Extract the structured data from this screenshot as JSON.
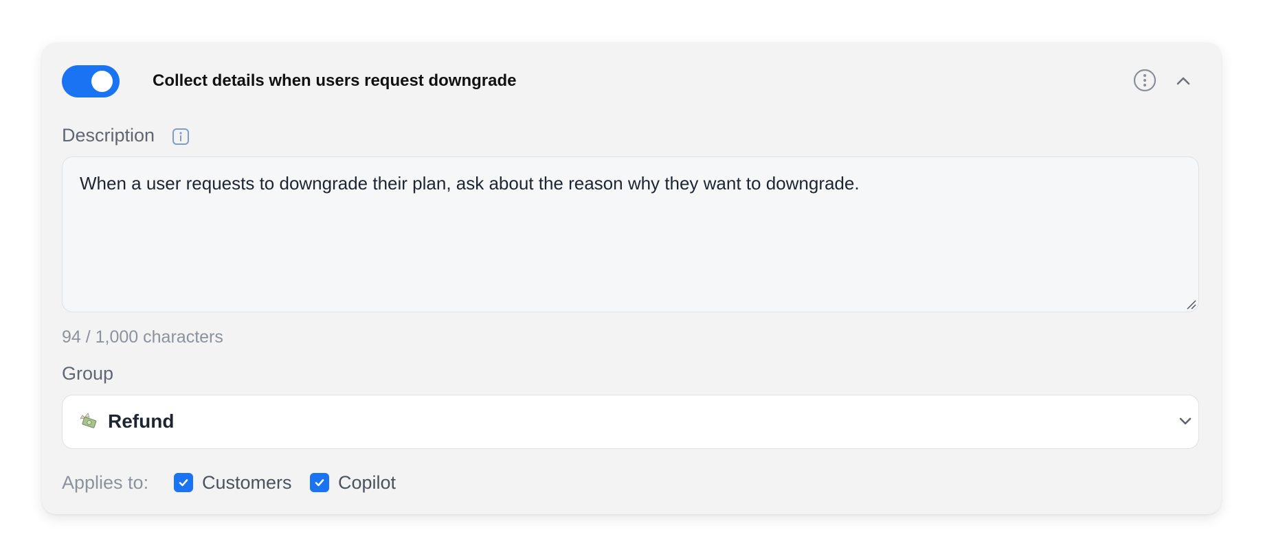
{
  "rule": {
    "enabled": true,
    "title": "Collect details when users request downgrade"
  },
  "description": {
    "label": "Description",
    "value": "When a user requests to downgrade their plan, ask about the reason why they want to downgrade.",
    "char_count": "94 / 1,000 characters"
  },
  "group": {
    "label": "Group",
    "icon": "money-with-wings-emoji",
    "selected": "Refund"
  },
  "applies_to": {
    "label": "Applies to:",
    "options": [
      {
        "label": "Customers",
        "checked": true
      },
      {
        "label": "Copilot",
        "checked": true
      }
    ]
  },
  "colors": {
    "accent": "#1a73f2",
    "card_bg": "#f3f3f4"
  }
}
